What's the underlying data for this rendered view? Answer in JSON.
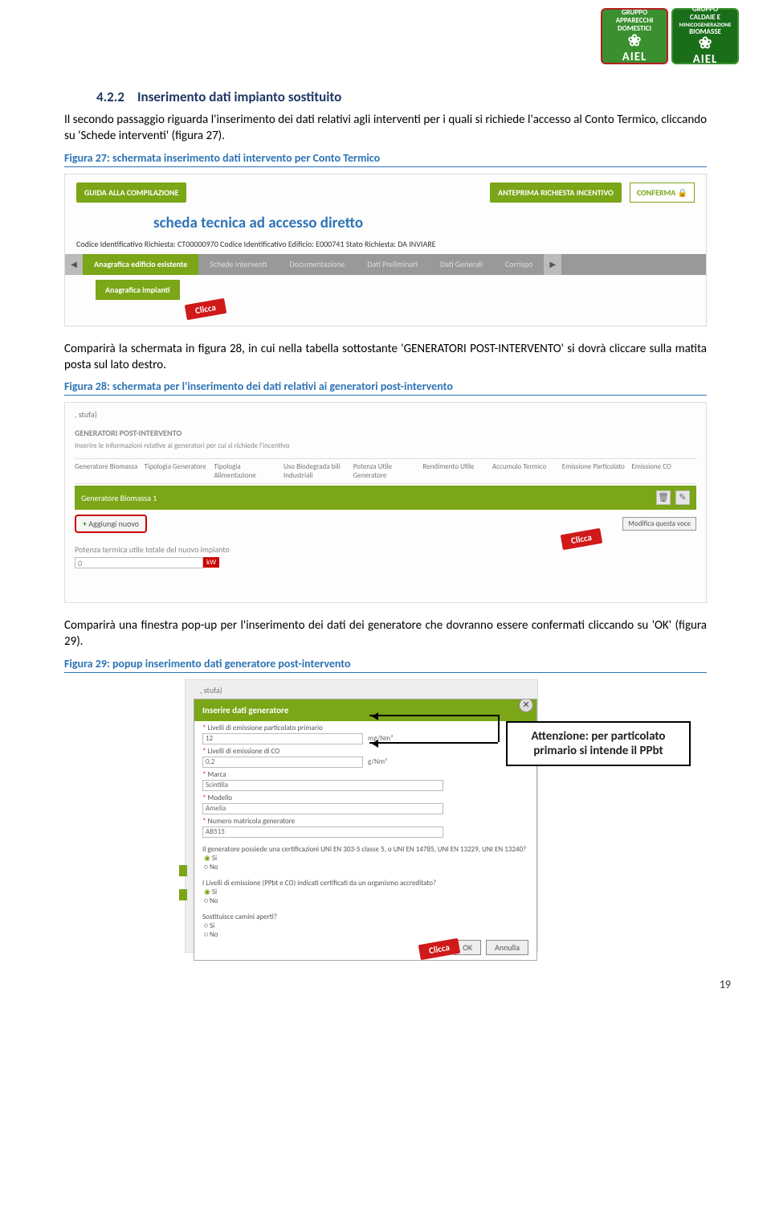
{
  "logos": {
    "l1": {
      "t1": "GRUPPO",
      "t2": "APPARECCHI",
      "t3": "DOMESTICI",
      "brand": "AIEL"
    },
    "l2": {
      "t1": "GRUPPO",
      "t2": "CALDAIE E",
      "t3": "MINICOGENERAZIONE",
      "t4": "BIOMASSE",
      "brand": "AIEL"
    }
  },
  "heading": {
    "num": "4.2.2",
    "text": "Inserimento dati impianto sostituito"
  },
  "p1": "Il secondo passaggio riguarda l'inserimento dei dati relativi agli interventi per i quali si richiede l'accesso al Conto Termico, cliccando su 'Schede interventi' (figura 27).",
  "cap27": "Figura 27: schermata inserimento dati intervento per Conto Termico",
  "fig27": {
    "guide": "GUIDA ALLA COMPILAZIONE",
    "anteprima": "ANTEPRIMA RICHIESTA INCENTIVO",
    "conferma": "CONFERMA 🔒",
    "title": "scheda tecnica ad accesso diretto",
    "idrow": "Codice Identificativo Richiesta: CT00000970     Codice Identificativo Edificio: E000741     Stato Richiesta: DA INVIARE",
    "tabs": [
      "Anagrafica edificio esistente",
      "Schede Interventi",
      "Documentazione",
      "Dati Preliminari",
      "Dati Generali",
      "Corrispo"
    ],
    "subtab": "Anagrafica impianti"
  },
  "clicca": "Clicca",
  "p2": "Comparirà la schermata in figura 28, in cui nella tabella sottostante 'GENERATORI POST-INTERVENTO' si dovrà cliccare sulla matita posta sul lato destro.",
  "cap28": "Figura 28: schermata per l'inserimento dei dati relativi ai generatori post-intervento",
  "fig28": {
    "stufa": ", stufa)",
    "hdr": "GENERATORI POST-INTERVENTO",
    "sub": "Inserire le informazioni relative ai generatori per cui si richiede l'incentivo",
    "cols": [
      "Generatore Biomassa",
      "Tipologia Generatore",
      "Tipologia Alimentazione",
      "Uso Biodegrada bili Industriali",
      "Potenza Utile Generatore",
      "Rendimento Utile",
      "Accumulo Termico",
      "Emissione Particolato",
      "Emissione CO"
    ],
    "selrow": "Generatore Biomassa 1",
    "add": "Aggiungi nuovo",
    "mod": "Modifica questa voce",
    "potlbl": "Potenza termica utile totale del nuovo impianto",
    "potval": "0",
    "kw": "kW"
  },
  "p3": "Comparirà una finestra pop-up per l'inserimento dei dati dei generatore che dovranno essere confermati cliccando su 'OK' (figura 29).",
  "cap29": "Figura 29: popup inserimento dati  generatore post-intervento",
  "fig29": {
    "stufa": ", stufa)",
    "title": "Inserire dati generatore",
    "f1": {
      "lab": "Livelli di emissione particolato primario",
      "val": "12",
      "unit": "mg/Nm³"
    },
    "f2": {
      "lab": "Livelli di emissione di CO",
      "val": "0,2",
      "unit": "g/Nm³"
    },
    "f3": {
      "lab": "Marca",
      "val": "Scintilla"
    },
    "f4": {
      "lab": "Modello",
      "val": "Amelia"
    },
    "f5": {
      "lab": "Numero matricola generatore",
      "val": "AB515"
    },
    "q1": "Il generatore possiede una certificazioni UNI EN 303-5 classe 5, o UNI EN 14785, UNI EN 13229, UNI EN 13240?",
    "q2": "I Livelli di emissione (PPbt e CO) indicati certificati da un organismo accreditato?",
    "q3": "Sostituisce camini aperti?",
    "si": "Si",
    "no": "No",
    "ok": "OK",
    "ann": "Annulla"
  },
  "attenzione": {
    "l1": "Attenzione: per particolato",
    "l2": "primario si intende il PPbt"
  },
  "pagenum": "19"
}
